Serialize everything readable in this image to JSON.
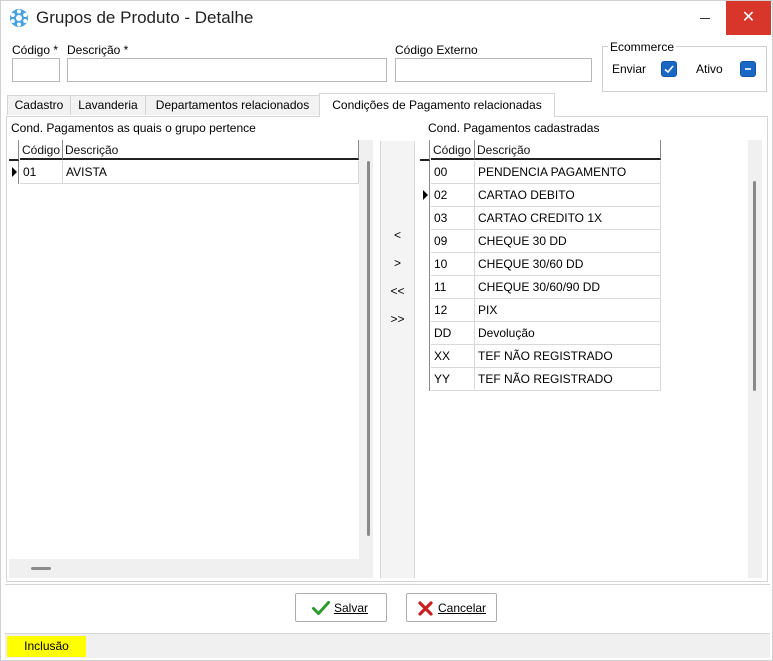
{
  "window": {
    "title": "Grupos de Produto - Detalhe",
    "close_glyph": "✕"
  },
  "form": {
    "codigo_label": "Código *",
    "descricao_label": "Descrição *",
    "codigo_externo_label": "Código Externo",
    "codigo_value": "",
    "descricao_value": "",
    "codigo_externo_value": ""
  },
  "ecommerce": {
    "title": "Ecommerce",
    "enviar_label": "Enviar",
    "ativo_label": "Ativo",
    "enviar_checked": true,
    "ativo_state": "indeterminate"
  },
  "tabs": [
    {
      "label": "Cadastro",
      "active": false
    },
    {
      "label": "Lavanderia",
      "active": false
    },
    {
      "label": "Departamentos relacionados",
      "active": false
    },
    {
      "label": "Condições de Pagamento relacionadas",
      "active": true
    }
  ],
  "left_grid": {
    "title": "Cond. Pagamentos as quais o grupo pertence",
    "columns": [
      "Código",
      "Descrição"
    ],
    "rows": [
      {
        "codigo": "01",
        "descricao": "AVISTA",
        "current": true
      }
    ]
  },
  "move_buttons": [
    "<",
    ">",
    "<<",
    ">>"
  ],
  "right_grid": {
    "title": "Cond. Pagamentos cadastradas",
    "columns": [
      "Código",
      "Descrição"
    ],
    "rows": [
      {
        "codigo": "00",
        "descricao": "PENDENCIA PAGAMENTO",
        "current": false
      },
      {
        "codigo": "02",
        "descricao": "CARTAO DEBITO",
        "current": true
      },
      {
        "codigo": "03",
        "descricao": "CARTAO CREDITO 1X",
        "current": false
      },
      {
        "codigo": "09",
        "descricao": "CHEQUE 30 DD",
        "current": false
      },
      {
        "codigo": "10",
        "descricao": "CHEQUE 30/60 DD",
        "current": false
      },
      {
        "codigo": "11",
        "descricao": "CHEQUE 30/60/90 DD",
        "current": false
      },
      {
        "codigo": "12",
        "descricao": "PIX",
        "current": false
      },
      {
        "codigo": "DD",
        "descricao": "Devolução",
        "current": false
      },
      {
        "codigo": "XX",
        "descricao": "TEF NÃO REGISTRADO",
        "current": false
      },
      {
        "codigo": "YY",
        "descricao": "TEF NÃO REGISTRADO",
        "current": false
      }
    ]
  },
  "buttons": {
    "salvar": "Salvar",
    "cancelar": "Cancelar"
  },
  "status": {
    "mode": "Inclusão"
  },
  "colors": {
    "accent": "#1a68c6",
    "close": "#d9362b",
    "status_bg": "#ffff00",
    "save_icon": "#2a9a2a",
    "cancel_icon": "#cc1e1e"
  }
}
